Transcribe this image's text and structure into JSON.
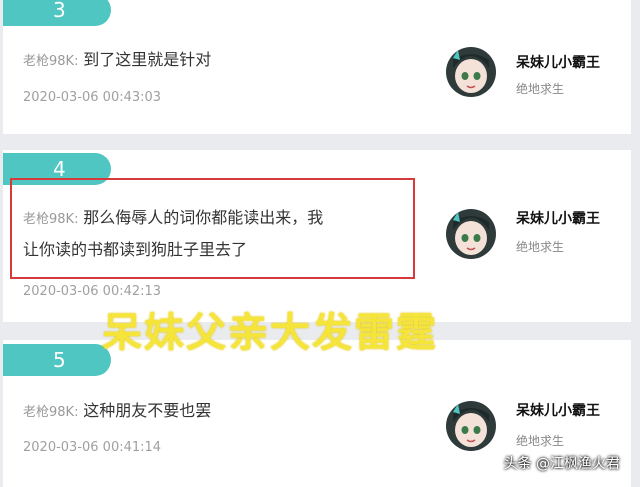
{
  "comments": [
    {
      "number": "3",
      "user": "老枪98K:",
      "text_lines": [
        "到了这里就是针对"
      ],
      "timestamp": "2020-03-06 00:43:03",
      "author": "呆妹儿小霸王",
      "role": "绝地求生"
    },
    {
      "number": "4",
      "user": "老枪98K:",
      "text_lines": [
        "那么侮辱人的词你都能读出来，我",
        "让你读的书都读到狗肚子里去了"
      ],
      "timestamp": "2020-03-06 00:42:13",
      "author": "呆妹儿小霸王",
      "role": "绝地求生"
    },
    {
      "number": "5",
      "user": "老枪98K:",
      "text_lines": [
        "这种朋友不要也罢"
      ],
      "timestamp": "2020-03-06 00:41:14",
      "author": "呆妹儿小霸王",
      "role": "绝地求生"
    }
  ],
  "overlay_caption": "呆妹父亲大发雷霆",
  "watermark": "头条 @江枫渔火君",
  "colors": {
    "tab": "#4fc6c2",
    "highlight": "#d63a3a",
    "caption": "#f5e43a"
  }
}
